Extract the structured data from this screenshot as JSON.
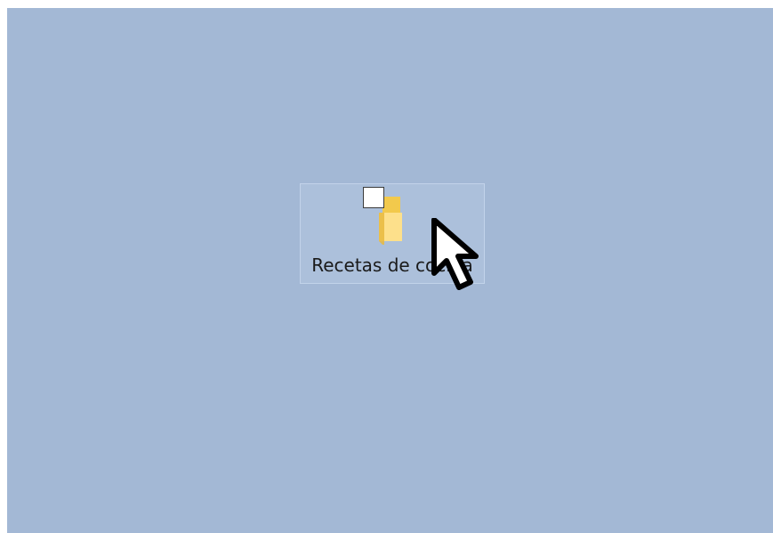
{
  "desktop": {
    "background_color": "#a3b8d5",
    "items": [
      {
        "label": "Recetas de cocina",
        "icon": "folder-icon",
        "selected": true,
        "checked": false
      }
    ]
  },
  "cursor": {
    "icon": "mouse-pointer-icon"
  }
}
